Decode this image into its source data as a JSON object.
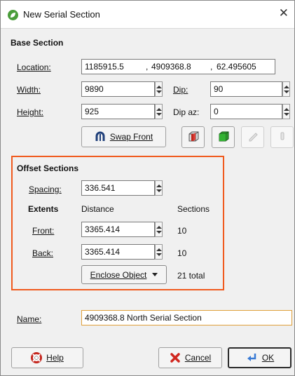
{
  "window": {
    "title": "New Serial Section",
    "close_glyph": "✕"
  },
  "base_section": {
    "heading": "Base Section",
    "location_label": "Location:",
    "location": {
      "x": "1185915.5",
      "sep1": ",",
      "y": "4909368.8",
      "sep2": ",",
      "z": "62.495605"
    },
    "width_label": "Width:",
    "width_value": "9890",
    "height_label": "Height:",
    "height_value": "925",
    "dip_label": "Dip:",
    "dip_value": "90",
    "dip_az_label": "Dip az:",
    "dip_az_value": "0",
    "swap_front_label": "Swap Front",
    "icons": [
      "swap-front-icon",
      "view-box-outline-icon",
      "view-box-solid-icon",
      "pencil-icon",
      "clip-icon"
    ]
  },
  "offset_sections": {
    "heading": "Offset Sections",
    "spacing_label": "Spacing:",
    "spacing_value": "336.541",
    "extents_label": "Extents",
    "distance_label": "Distance",
    "sections_label": "Sections",
    "front_label": "Front:",
    "front_value": "3365.414",
    "front_sections": "10",
    "back_label": "Back:",
    "back_value": "3365.414",
    "back_sections": "10",
    "enclose_label": "Enclose Object",
    "total_label": "21 total",
    "highlight_color": "#f05a1e"
  },
  "name": {
    "label": "Name:",
    "value": "4909368.8 North Serial Section"
  },
  "footer": {
    "help_label": "Help",
    "cancel_label": "Cancel",
    "ok_label": "OK"
  },
  "colors": {
    "accent": "#f05a1e",
    "dialog_bg": "#f0f0f0",
    "title_icon": "#4a9d3a"
  }
}
